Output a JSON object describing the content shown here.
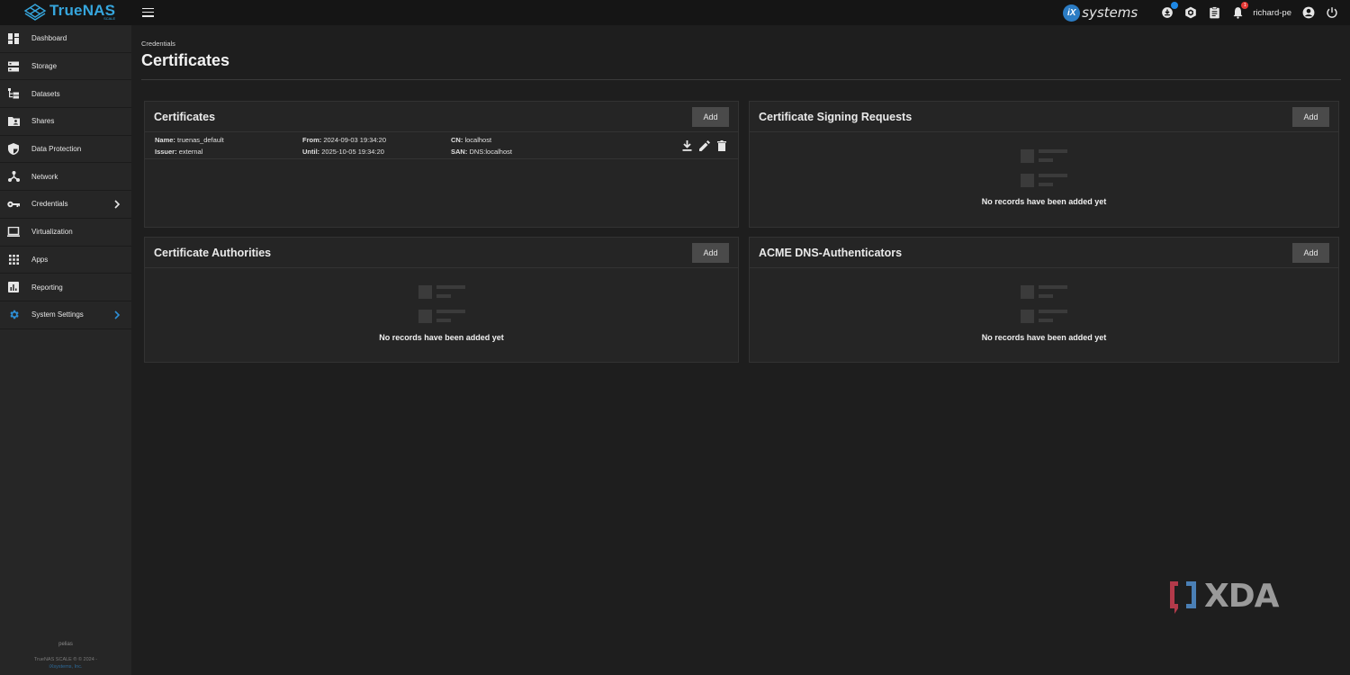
{
  "app": {
    "name": "TrueNAS",
    "edition": "SCALE",
    "brand_color": "#36a6dd"
  },
  "topbar": {
    "vendor_logo": "systems",
    "vendor_logo_mark": "iX",
    "jobs_badge": "1",
    "alerts_badge": "1",
    "username": "richard-pe",
    "icons": [
      "menu-icon",
      "updates-icon",
      "truecommand-icon",
      "jobs-icon",
      "alerts-icon",
      "account-icon",
      "power-icon"
    ]
  },
  "sidebar": {
    "items": [
      {
        "label": "Dashboard",
        "icon": "dashboard-icon"
      },
      {
        "label": "Storage",
        "icon": "storage-icon"
      },
      {
        "label": "Datasets",
        "icon": "datasets-icon"
      },
      {
        "label": "Shares",
        "icon": "shares-icon"
      },
      {
        "label": "Data Protection",
        "icon": "shield-icon"
      },
      {
        "label": "Network",
        "icon": "network-icon"
      },
      {
        "label": "Credentials",
        "icon": "key-icon"
      },
      {
        "label": "Virtualization",
        "icon": "laptop-icon"
      },
      {
        "label": "Apps",
        "icon": "apps-grid-icon"
      },
      {
        "label": "Reporting",
        "icon": "reporting-icon"
      },
      {
        "label": "System Settings",
        "icon": "gear-icon"
      }
    ],
    "hostname": "pelias",
    "copyright": "TrueNAS SCALE ® © 2024 -",
    "company": "iXsystems, Inc."
  },
  "page": {
    "breadcrumb": "Credentials",
    "title": "Certificates"
  },
  "cards": {
    "certificates": {
      "title": "Certificates",
      "add_label": "Add",
      "rows": [
        {
          "name_label": "Name:",
          "name": "truenas_default",
          "issuer_label": "Issuer:",
          "issuer": "external",
          "from_label": "From:",
          "from": "2024-09-03 19:34:20",
          "until_label": "Until:",
          "until": "2025-10-05 19:34:20",
          "cn_label": "CN:",
          "cn": "localhost",
          "san_label": "SAN:",
          "san": "DNS:localhost"
        }
      ]
    },
    "csr": {
      "title": "Certificate Signing Requests",
      "add_label": "Add",
      "empty_text": "No records have been added yet"
    },
    "authorities": {
      "title": "Certificate Authorities",
      "add_label": "Add",
      "empty_text": "No records have been added yet"
    },
    "acme": {
      "title": "ACME DNS-Authenticators",
      "add_label": "Add",
      "empty_text": "No records have been added yet"
    }
  },
  "watermark": {
    "text": "XDA"
  }
}
